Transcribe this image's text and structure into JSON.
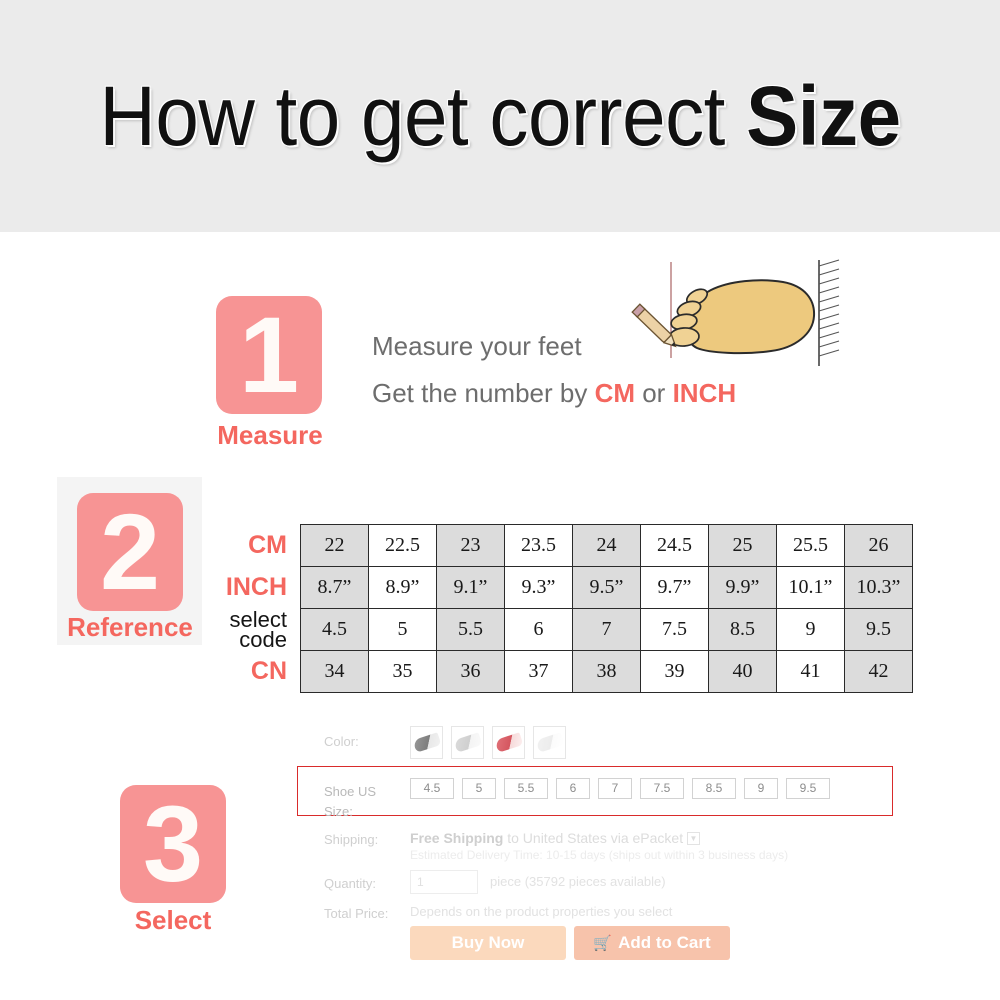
{
  "header": {
    "title_normal": "How to get correct ",
    "title_bold": "Size"
  },
  "steps": [
    {
      "number": "1",
      "caption": "Measure"
    },
    {
      "number": "2",
      "caption": "Reference"
    },
    {
      "number": "3",
      "caption": "Select"
    }
  ],
  "step1": {
    "line1": "Measure your feet",
    "line2_prefix": "Get the number by ",
    "line2_cm": "CM",
    "line2_or": " or ",
    "line2_inch": "INCH",
    "illustration": "foot-with-pencil-and-ruler"
  },
  "chart_data": {
    "type": "table",
    "title": "Shoe size reference table",
    "row_labels": [
      "CM",
      "INCH",
      "select code",
      "CN"
    ],
    "rows": [
      {
        "label": "CM",
        "values": [
          "22",
          "22.5",
          "23",
          "23.5",
          "24",
          "24.5",
          "25",
          "25.5",
          "26"
        ]
      },
      {
        "label": "INCH",
        "values": [
          "8.7”",
          "8.9”",
          "9.1”",
          "9.3”",
          "9.5”",
          "9.7”",
          "9.9”",
          "10.1”",
          "10.3”"
        ]
      },
      {
        "label": "select code",
        "values": [
          "4.5",
          "5",
          "5.5",
          "6",
          "7",
          "7.5",
          "8.5",
          "9",
          "9.5"
        ]
      },
      {
        "label": "CN",
        "values": [
          "34",
          "35",
          "36",
          "37",
          "38",
          "39",
          "40",
          "41",
          "42"
        ]
      }
    ],
    "shaded_columns": [
      0,
      2,
      4,
      6,
      8
    ],
    "label_accent_color": "#f4675f",
    "cell_shade_color": "#dcdcdc"
  },
  "order_panel": {
    "color": {
      "label": "Color:",
      "swatches": [
        "shoe-swatch-grey",
        "shoe-swatch-light-grey",
        "shoe-swatch-red",
        "shoe-swatch-white"
      ]
    },
    "shoe_size": {
      "label_line1": "Shoe US",
      "label_line2": "Size:",
      "options": [
        "4.5",
        "5",
        "5.5",
        "6",
        "7",
        "7.5",
        "8.5",
        "9",
        "9.5"
      ],
      "highlight_color": "#d92b2b"
    },
    "shipping": {
      "label": "Shipping:",
      "free_text": "Free Shipping",
      "rest_text": " to United States via ePacket",
      "estimate": "Estimated Delivery Time: 10-15 days (ships out within 3 business days)"
    },
    "quantity": {
      "label": "Quantity:",
      "value": "1",
      "note": "piece (35792 pieces available)"
    },
    "total_price": {
      "label": "Total Price:",
      "value": "Depends on the product properties you select"
    },
    "buttons": {
      "buy_now": "Buy Now",
      "add_to_cart": "Add to Cart",
      "cart_icon": "Ὥ2"
    }
  },
  "colors": {
    "header_band": "#ebebeb",
    "badge_pink": "#f79494",
    "accent_red": "#f4675f",
    "buy_now_bg": "#fbd9bd",
    "add_cart_bg": "#f7c3ab"
  }
}
